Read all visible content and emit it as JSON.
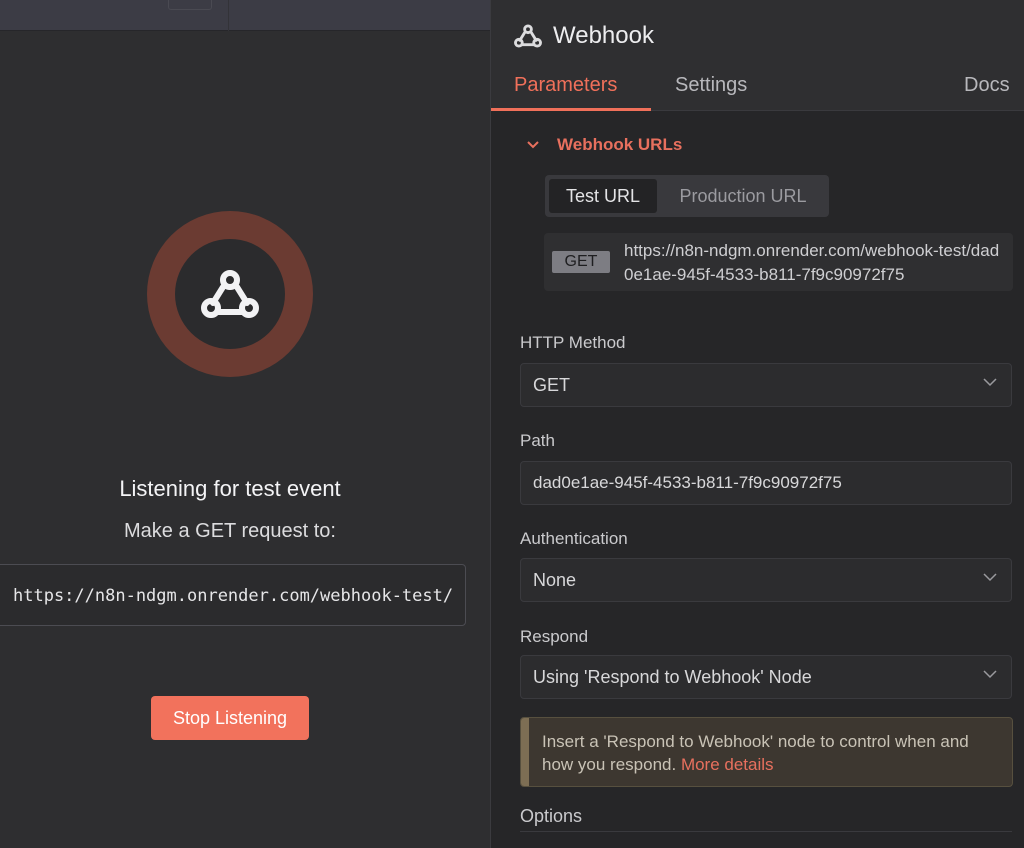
{
  "left": {
    "listening_title": "Listening for test event",
    "request_instruction": "Make a GET request to:",
    "webhook_url": "https://n8n-ndgm.onrender.com/webhook-test/",
    "stop_button_label": "Stop Listening"
  },
  "node": {
    "title": "Webhook",
    "tabs": [
      {
        "label": "Parameters",
        "active": true
      },
      {
        "label": "Settings",
        "active": false
      },
      {
        "label": "Docs",
        "active": false
      }
    ]
  },
  "webhook_urls": {
    "section_label": "Webhook URLs",
    "toggle_options": [
      "Test URL",
      "Production URL"
    ],
    "selected": "Test URL",
    "method_badge": "GET",
    "url": "https://n8n-ndgm.onrender.com/webhook-test/dad0e1ae-945f-4533-b811-7f9c90972f75"
  },
  "fields": {
    "http_method": {
      "label": "HTTP Method",
      "value": "GET"
    },
    "path": {
      "label": "Path",
      "value": "dad0e1ae-945f-4533-b811-7f9c90972f75"
    },
    "authentication": {
      "label": "Authentication",
      "value": "None"
    },
    "respond": {
      "label": "Respond",
      "value": "Using 'Respond to Webhook' Node"
    }
  },
  "notice": {
    "text": "Insert a 'Respond to Webhook' node to control when and how you respond.",
    "link": "More details"
  },
  "options_label": "Options",
  "colors": {
    "accent": "#f0705a",
    "button": "#f2725c",
    "ring": "#6b3b32"
  }
}
